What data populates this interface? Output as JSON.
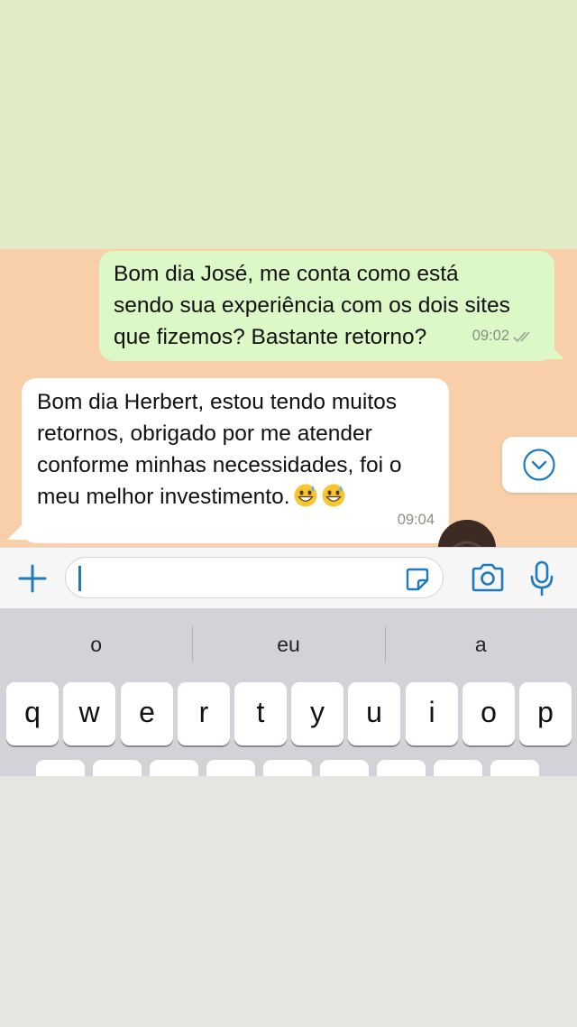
{
  "messages": {
    "outgoing": {
      "lines": [
        "Bom dia José, me conta como está",
        "sendo sua experiência com os dois sites",
        "que fizemos? Bastante retorno?"
      ],
      "time": "09:02",
      "status_icon": "double-check-icon"
    },
    "incoming": {
      "lines": [
        "Bom dia Herbert, estou tendo muitos",
        "retornos, obrigado por me atender",
        "conforme minhas necessidades, foi o",
        "meu melhor investimento."
      ],
      "emojis": [
        "grinning-sweat-emoji",
        "grinning-sweat-emoji"
      ],
      "time": "09:04"
    }
  },
  "composer": {
    "value": "",
    "icons": [
      "plus-icon",
      "sticker-icon",
      "camera-icon",
      "microphone-icon"
    ]
  },
  "keyboard": {
    "suggestions": [
      "o",
      "eu",
      "a"
    ],
    "row1": [
      "q",
      "w",
      "e",
      "r",
      "t",
      "y",
      "u",
      "i",
      "o",
      "p"
    ]
  },
  "colors": {
    "top_background": "#e0eac4",
    "chat_background": "#f8cfa8",
    "outgoing_bubble": "#dcf8c6",
    "incoming_bubble": "#ffffff",
    "accent": "#1e7abf"
  }
}
